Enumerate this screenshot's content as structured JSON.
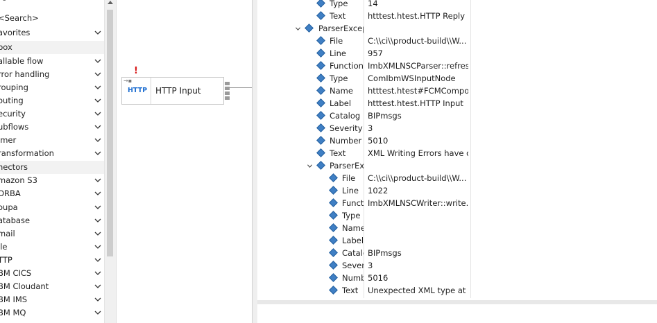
{
  "palette": {
    "items": [
      {
        "label": "<Search>",
        "kind": "search"
      },
      {
        "label": "avorites",
        "kind": "item",
        "chevron": true
      },
      {
        "label": "box",
        "kind": "drawer"
      },
      {
        "label": "allable flow",
        "kind": "item",
        "chevron": true
      },
      {
        "label": "rror handling",
        "kind": "item",
        "chevron": true
      },
      {
        "label": "rouping",
        "kind": "item",
        "chevron": true
      },
      {
        "label": "outing",
        "kind": "item",
        "chevron": true
      },
      {
        "label": "ecurity",
        "kind": "item",
        "chevron": true
      },
      {
        "label": "ubflows",
        "kind": "item",
        "chevron": true
      },
      {
        "label": "imer",
        "kind": "item",
        "chevron": true
      },
      {
        "label": "ransformation",
        "kind": "item",
        "chevron": true
      },
      {
        "label": "nectors",
        "kind": "drawer"
      },
      {
        "label": "mazon S3",
        "kind": "item",
        "chevron": true
      },
      {
        "label": "ORBA",
        "kind": "item",
        "chevron": true
      },
      {
        "label": "oupa",
        "kind": "item",
        "chevron": true
      },
      {
        "label": "atabase",
        "kind": "item",
        "chevron": true
      },
      {
        "label": "mail",
        "kind": "item",
        "chevron": true
      },
      {
        "label": "ile",
        "kind": "item",
        "chevron": true
      },
      {
        "label": "TTP",
        "kind": "item",
        "chevron": true
      },
      {
        "label": "BM CICS",
        "kind": "item",
        "chevron": true
      },
      {
        "label": "BM Cloudant",
        "kind": "item",
        "chevron": true
      },
      {
        "label": "BM IMS",
        "kind": "item",
        "chevron": true
      },
      {
        "label": "BM MQ",
        "kind": "item",
        "chevron": true
      }
    ]
  },
  "canvas": {
    "node": {
      "icon_text": "HTTP",
      "name": "HTTP Input",
      "error_mark": "!",
      "icon": "http-icon"
    }
  },
  "tree": {
    "rows": [
      {
        "level": 2,
        "prop": "Type",
        "value": "14"
      },
      {
        "level": 2,
        "prop": "Text",
        "value": "htttest.htest.HTTP Reply"
      },
      {
        "level": 1,
        "prop": "ParserExcept",
        "value": "",
        "expanded": true
      },
      {
        "level": 2,
        "prop": "File",
        "value": "C:\\\\ci\\\\product-build\\\\W..."
      },
      {
        "level": 2,
        "prop": "Line",
        "value": "957"
      },
      {
        "level": 2,
        "prop": "Function",
        "value": "ImbXMLNSCParser::refres..."
      },
      {
        "level": 2,
        "prop": "Type",
        "value": "ComIbmWSInputNode"
      },
      {
        "level": 2,
        "prop": "Name",
        "value": "htttest.htest#FCMCompo..."
      },
      {
        "level": 2,
        "prop": "Label",
        "value": "htttest.htest.HTTP Input"
      },
      {
        "level": 2,
        "prop": "Catalog",
        "value": "BIPmsgs"
      },
      {
        "level": 2,
        "prop": "Severity",
        "value": "3"
      },
      {
        "level": 2,
        "prop": "Number",
        "value": "5010"
      },
      {
        "level": 2,
        "prop": "Text",
        "value": "XML Writing Errors have o..."
      },
      {
        "level": 2,
        "prop": "ParserExc",
        "value": "",
        "expanded": true
      },
      {
        "level": 3,
        "prop": "File",
        "value": "C:\\\\ci\\\\product-build\\\\W..."
      },
      {
        "level": 3,
        "prop": "Line",
        "value": "1022"
      },
      {
        "level": 3,
        "prop": "Functi",
        "value": "ImbXMLNSCWriter::write..."
      },
      {
        "level": 3,
        "prop": "Type",
        "value": ""
      },
      {
        "level": 3,
        "prop": "Name",
        "value": ""
      },
      {
        "level": 3,
        "prop": "Label",
        "value": ""
      },
      {
        "level": 3,
        "prop": "Catalo",
        "value": "BIPmsgs"
      },
      {
        "level": 3,
        "prop": "Severit",
        "value": "3"
      },
      {
        "level": 3,
        "prop": "Numb",
        "value": "5016"
      },
      {
        "level": 3,
        "prop": "Text",
        "value": "Unexpected XML type at t..."
      }
    ]
  },
  "colors": {
    "accent": "#1f6fd1",
    "error": "#d81b1b",
    "diamond": "#3f7fc4"
  }
}
